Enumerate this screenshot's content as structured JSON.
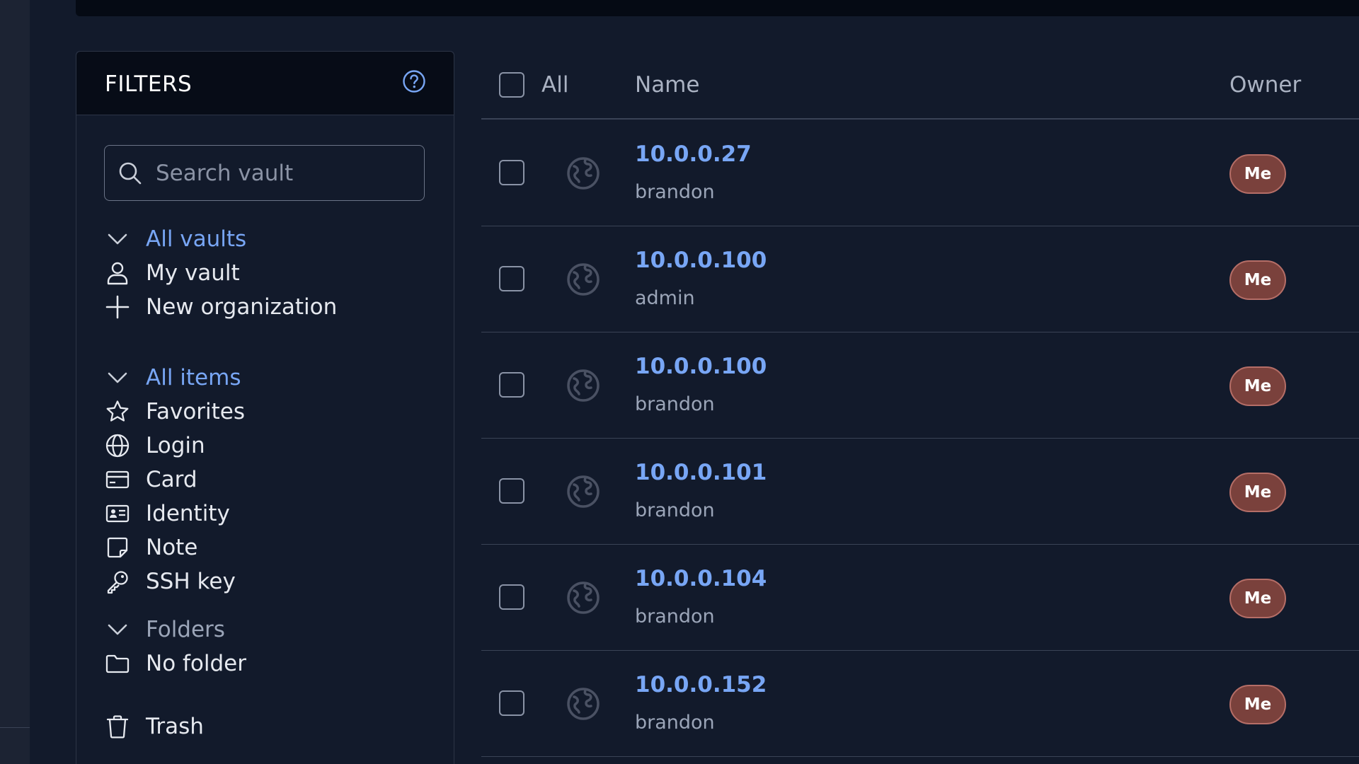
{
  "filters": {
    "title": "FILTERS",
    "help_icon": "question-circle-icon",
    "search": {
      "placeholder": "Search vault",
      "value": ""
    },
    "vaults": {
      "group_label": "All vaults",
      "items": [
        {
          "label": "My vault",
          "icon": "user-icon"
        },
        {
          "label": "New organization",
          "icon": "plus-icon"
        }
      ]
    },
    "types": {
      "group_label": "All items",
      "items": [
        {
          "label": "Favorites",
          "icon": "star-icon"
        },
        {
          "label": "Login",
          "icon": "globe-icon"
        },
        {
          "label": "Card",
          "icon": "credit-card-icon"
        },
        {
          "label": "Identity",
          "icon": "id-card-icon"
        },
        {
          "label": "Note",
          "icon": "note-icon"
        },
        {
          "label": "SSH key",
          "icon": "key-icon"
        }
      ]
    },
    "folders": {
      "group_label": "Folders",
      "items": [
        {
          "label": "No folder",
          "icon": "folder-icon"
        }
      ]
    },
    "trash": {
      "label": "Trash",
      "icon": "trash-icon"
    }
  },
  "table": {
    "headers": {
      "all": "All",
      "name": "Name",
      "owner": "Owner"
    },
    "rows": [
      {
        "name": "10.0.0.27",
        "username": "brandon",
        "owner": "Me"
      },
      {
        "name": "10.0.0.100",
        "username": "admin",
        "owner": "Me"
      },
      {
        "name": "10.0.0.100",
        "username": "brandon",
        "owner": "Me"
      },
      {
        "name": "10.0.0.101",
        "username": "brandon",
        "owner": "Me"
      },
      {
        "name": "10.0.0.104",
        "username": "brandon",
        "owner": "Me"
      },
      {
        "name": "10.0.0.152",
        "username": "brandon",
        "owner": "Me"
      }
    ]
  },
  "colors": {
    "background": "#121a2b",
    "accent": "#78a6f5",
    "owner_badge": "#7a413c"
  }
}
